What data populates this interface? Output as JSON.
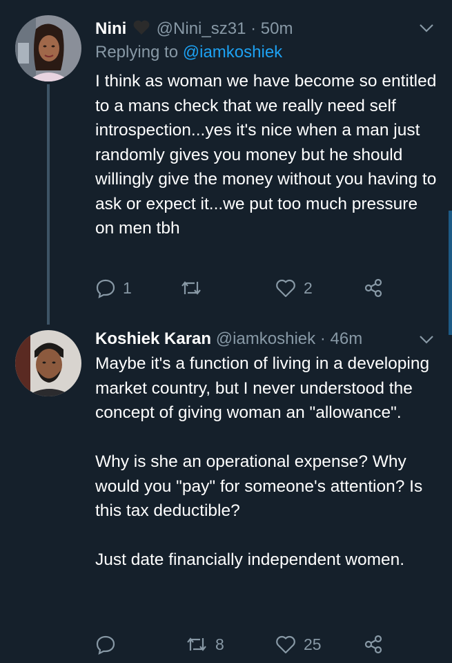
{
  "tweets": [
    {
      "display_name": "Nini",
      "handle": "@Nini_sz31",
      "separator": "·",
      "time": "50m",
      "replying_to_prefix": "Replying to",
      "replying_to_handle": "@iamkoshiek",
      "text": "I think as woman we have become so entitled to a mans check that we really need self introspection...yes it's nice when a man just randomly gives you money but he should willingly give the money without you having to ask or expect it...we put too much pressure on men tbh",
      "reply_count": "1",
      "retweet_count": "",
      "like_count": "2"
    },
    {
      "display_name": "Koshiek Karan",
      "handle": "@iamkoshiek",
      "separator": "·",
      "time": "46m",
      "paragraphs": [
        "Maybe it's a function of living in a developing market country, but I never understood the concept of giving woman an \"allowance\".",
        "Why is she an operational expense? Why would you \"pay\" for someone's attention? Is this tax deductible?",
        "Just date financially independent women."
      ],
      "reply_count": "",
      "retweet_count": "8",
      "like_count": "25"
    }
  ],
  "colors": {
    "background": "#15202b",
    "muted": "#8899a6",
    "link": "#1da1f2",
    "thread_line": "#3d5466"
  }
}
